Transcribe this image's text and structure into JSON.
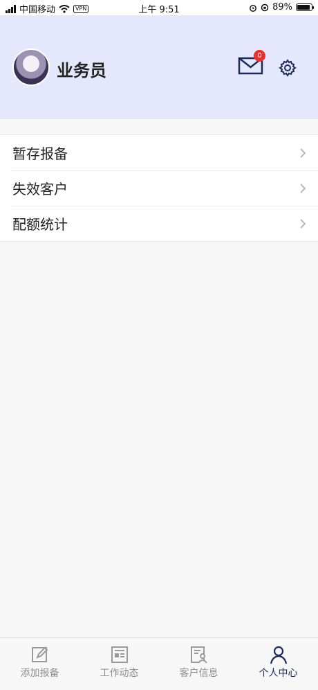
{
  "status_bar": {
    "carrier": "中国移动",
    "vpn": "VPN",
    "time": "上午 9:51",
    "battery": "89%"
  },
  "header": {
    "username": "业务员",
    "mail_badge": "0"
  },
  "menu": {
    "items": [
      {
        "label": "暂存报备"
      },
      {
        "label": "失效客户"
      },
      {
        "label": "配额统计"
      }
    ]
  },
  "tabbar": {
    "tabs": [
      {
        "label": "添加报备",
        "icon": "edit-icon"
      },
      {
        "label": "工作动态",
        "icon": "news-icon"
      },
      {
        "label": "客户信息",
        "icon": "customer-info-icon"
      },
      {
        "label": "个人中心",
        "icon": "user-icon"
      }
    ],
    "active": "个人中心"
  },
  "colors": {
    "header_bg": "#e5e8fd",
    "accent": "#1b2a57",
    "badge": "#e8322d"
  }
}
